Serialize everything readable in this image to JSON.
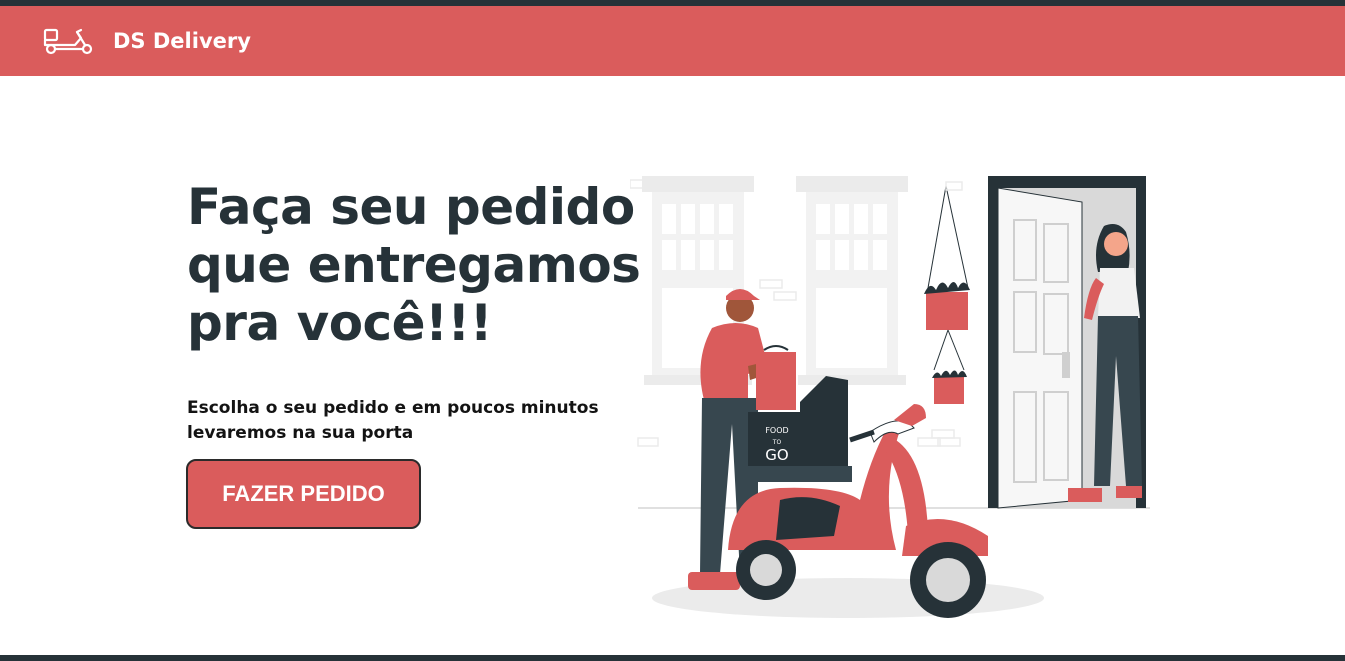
{
  "navbar": {
    "brand": "DS Delivery",
    "logo_icon": "scooter-icon",
    "background": "#DA5C5C"
  },
  "hero": {
    "headline": "Faça seu pedido que entregamos pra você!!!",
    "subtitle": "Escolha o seu pedido e em poucos minutos levaremos na sua porta",
    "cta_label": "FAZER PEDIDO",
    "illustration": {
      "box_text_top": "FOOD",
      "box_text_mid": "TO",
      "box_text_bottom": "GO"
    }
  },
  "colors": {
    "primary": "#DA5C5C",
    "dark": "#263238",
    "text": "#131313"
  }
}
